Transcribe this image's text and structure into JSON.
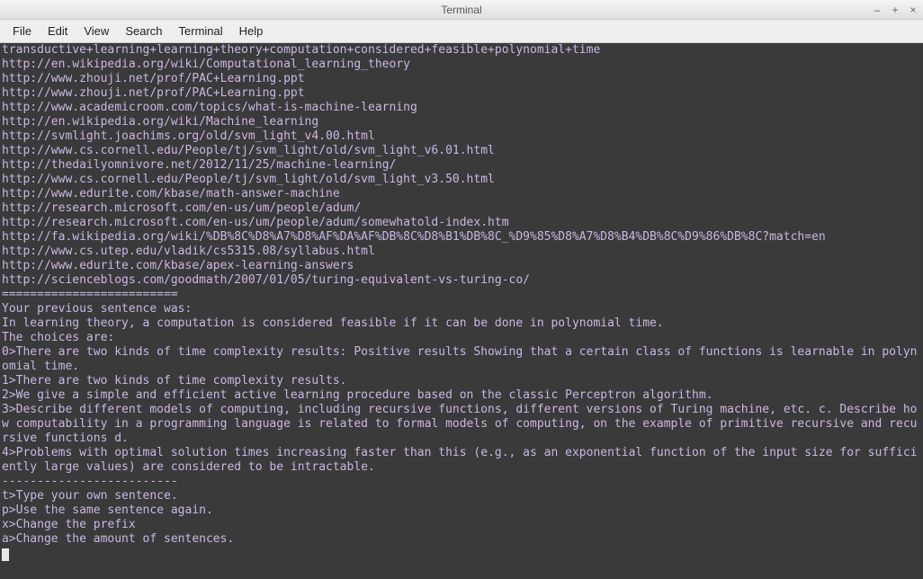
{
  "window": {
    "title": "Terminal",
    "controls": {
      "minimize": "–",
      "maximize": "+",
      "close": "×"
    }
  },
  "menubar": {
    "items": [
      "File",
      "Edit",
      "View",
      "Search",
      "Terminal",
      "Help"
    ]
  },
  "terminal": {
    "lines": [
      "transductive+learning+learning+theory+computation+considered+feasible+polynomial+time",
      "http://en.wikipedia.org/wiki/Computational_learning_theory",
      "http://www.zhouji.net/prof/PAC+Learning.ppt",
      "http://www.zhouji.net/prof/PAC+Learning.ppt",
      "http://www.academicroom.com/topics/what-is-machine-learning",
      "http://en.wikipedia.org/wiki/Machine_learning",
      "http://svmlight.joachims.org/old/svm_light_v4.00.html",
      "http://www.cs.cornell.edu/People/tj/svm_light/old/svm_light_v6.01.html",
      "http://thedailyomnivore.net/2012/11/25/machine-learning/",
      "http://www.cs.cornell.edu/People/tj/svm_light/old/svm_light_v3.50.html",
      "http://www.edurite.com/kbase/math-answer-machine",
      "http://research.microsoft.com/en-us/um/people/adum/",
      "http://research.microsoft.com/en-us/um/people/adum/somewhatold-index.htm",
      "http://fa.wikipedia.org/wiki/%DB%8C%D8%A7%D8%AF%DA%AF%DB%8C%D8%B1%DB%8C_%D9%85%D8%A7%D8%B4%DB%8C%D9%86%DB%8C?match=en",
      "http://www.cs.utep.edu/vladik/cs5315.08/syllabus.html",
      "http://www.edurite.com/kbase/apex-learning-answers",
      "http://scienceblogs.com/goodmath/2007/01/05/turing-equivalent-vs-turing-co/",
      "=========================",
      "Your previous sentence was:",
      "In learning theory, a computation is considered feasible if it can be done in polynomial time.",
      "",
      "The choices are:",
      "0>There are two kinds of time complexity results: Positive results Showing that a certain class of functions is learnable in polynomial time.",
      "1>There are two kinds of time complexity results.",
      "2>We give a simple and efficient active learning procedure based on the classic Perceptron algorithm.",
      "3>Describe different models of computing, including recursive functions, different versions of Turing machine, etc. c. Describe how computability in a programming language is related to formal models of computing, on the example of primitive recursive and recursive functions d.",
      "4>Problems with optimal solution times increasing faster than this (e.g., as an exponential function of the input size for sufficiently large values) are considered to be intractable.",
      "-------------------------",
      "t>Type your own sentence.",
      "p>Use the same sentence again.",
      "x>Change the prefix",
      "a>Change the amount of sentences."
    ]
  }
}
